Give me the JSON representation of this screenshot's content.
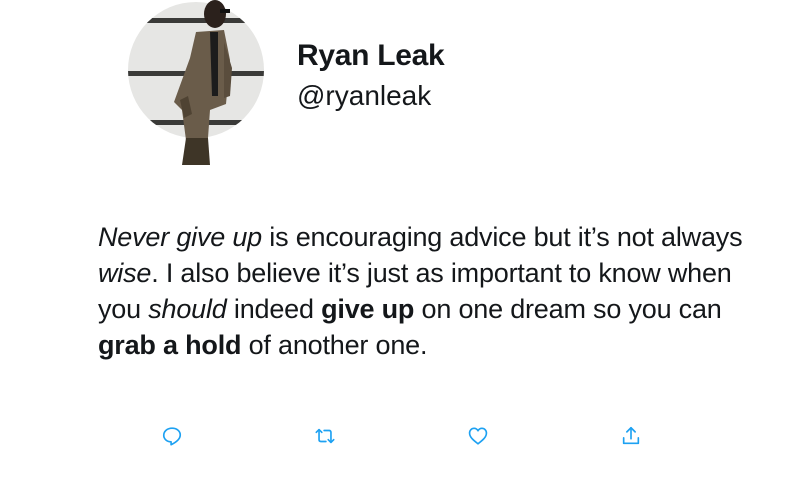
{
  "profile": {
    "display_name": "Ryan Leak",
    "handle": "@ryanleak",
    "avatar_icon": "profile-photo"
  },
  "tweet": {
    "segments": [
      {
        "text": "Never give up",
        "style": "italic"
      },
      {
        "text": " is encouraging advice but it’s not always ",
        "style": "normal"
      },
      {
        "text": "wise",
        "style": "italic"
      },
      {
        "text": ". I also believe it’s just as important to know when you ",
        "style": "normal"
      },
      {
        "text": "should",
        "style": "italic"
      },
      {
        "text": " indeed ",
        "style": "normal"
      },
      {
        "text": "give up",
        "style": "bold"
      },
      {
        "text": " on one dream so you can ",
        "style": "normal"
      },
      {
        "text": "grab a hold",
        "style": "bold"
      },
      {
        "text": " of another one.",
        "style": "normal"
      }
    ]
  },
  "actions": {
    "reply_icon": "reply-icon",
    "retweet_icon": "retweet-icon",
    "like_icon": "like-icon",
    "share_icon": "share-icon",
    "accent_color": "#1da1f2"
  }
}
